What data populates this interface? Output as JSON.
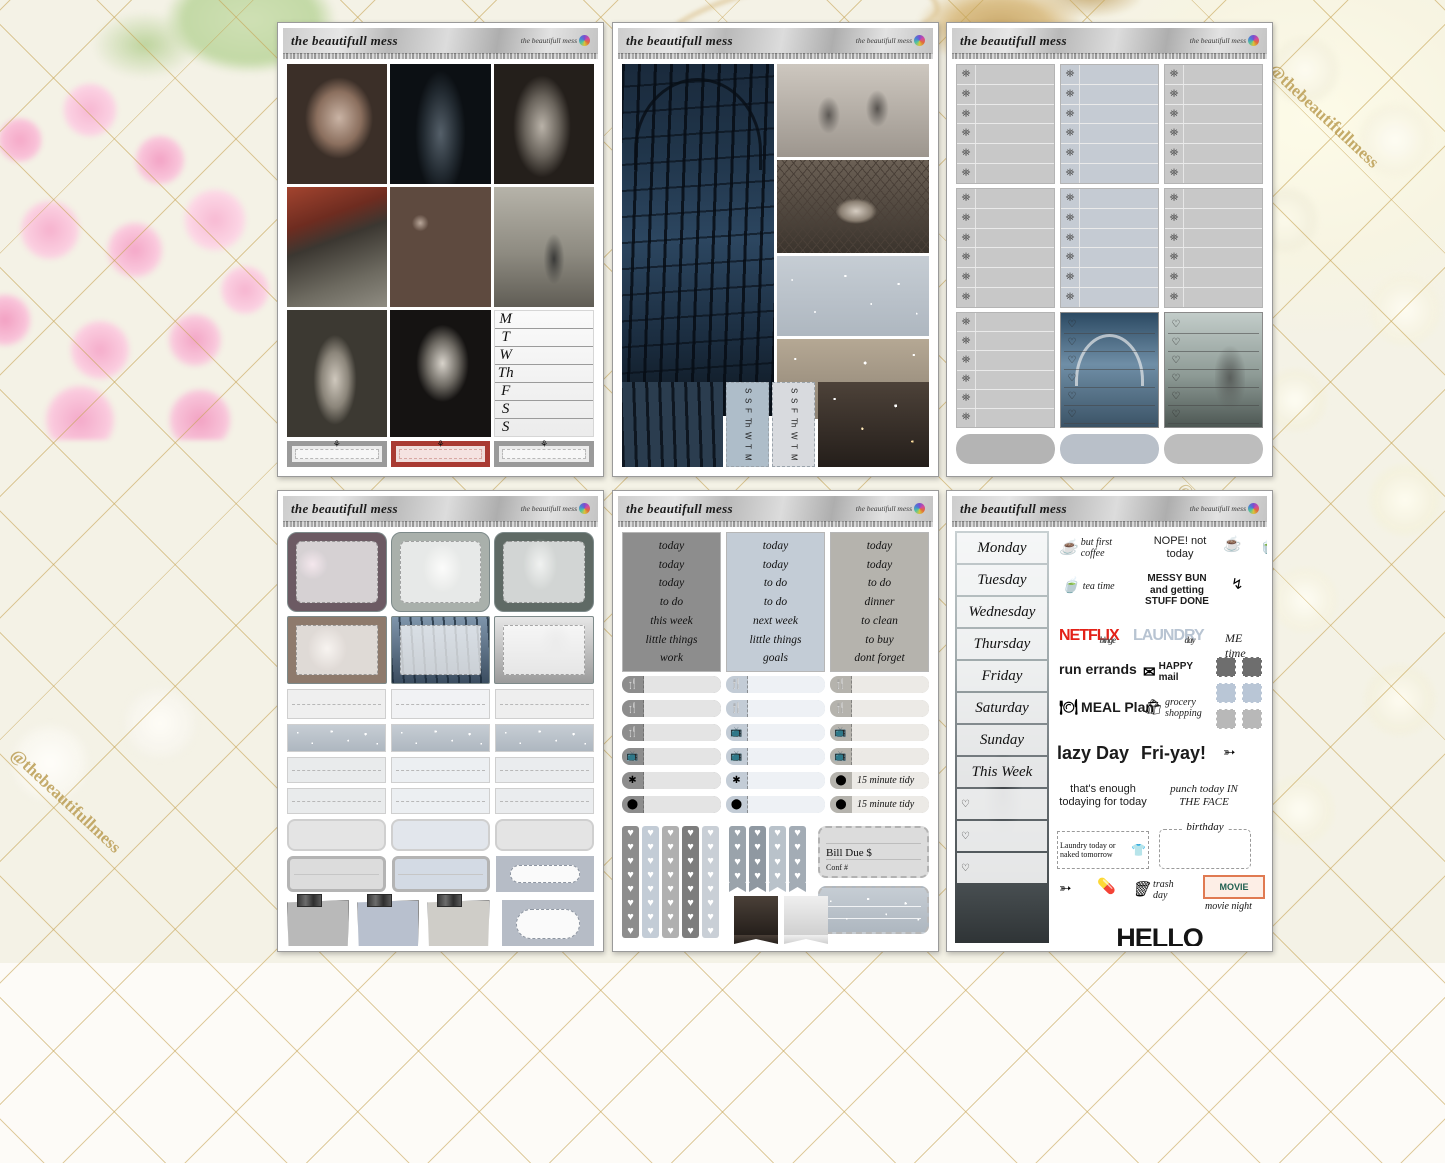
{
  "watermark": {
    "text": "@thebeautifullmess"
  },
  "brand": {
    "title": "the beautifull mess",
    "small": "the beautifull mess",
    "logo_icon": "rainbow-circle-logo"
  },
  "sheets": [
    {
      "id": "sheet-1",
      "name": "horror-photo-weekly-kit",
      "photos": [
        "zombie-woman-portrait",
        "dark-corridor-figure",
        "girl-with-camera",
        "crawling-figure-field",
        "bloody-hands-zombie",
        "lone-figure-fog",
        "bare-feet-walking",
        "long-hair-ghost-girl"
      ],
      "weekly_days": [
        "M",
        "T",
        "W",
        "Th",
        "F",
        "S",
        "S"
      ],
      "bow_boxes": [
        {
          "icon": "bow-icon",
          "accent": "#9a9a9a"
        },
        {
          "icon": "bow-icon",
          "accent": "#a93a32"
        },
        {
          "icon": "bow-icon",
          "accent": "#b5b5b5"
        }
      ]
    },
    {
      "id": "sheet-2",
      "name": "gothic-gate-photo-kit",
      "photos": [
        "gothic-iron-gate-tall",
        "iron-fence-gate",
        "shadow-hands-frosted-glass",
        "hand-reaching-net",
        "silver-glitter-texture",
        "gold-glitter-texture",
        "cemetery-gate-detail"
      ],
      "vertical_days": [
        "M",
        "T",
        "W",
        "Th",
        "F",
        "S",
        "S"
      ]
    },
    {
      "id": "sheet-3",
      "name": "tombstone-checklist-kit",
      "icon": "tombstone-icon",
      "columns": [
        {
          "rows": 12,
          "shade": "#c8c8c8"
        },
        {
          "rows": 12,
          "shade": "#c5cbd3"
        },
        {
          "rows": 12,
          "shade": "#c8c8c8"
        }
      ],
      "heart_lists": [
        {
          "icon": "heart-icon",
          "bg": "cemetery-arch-photo",
          "rows": 6
        },
        {
          "icon": "heart-icon",
          "bg": "figure-in-mist-photo",
          "rows": 6
        }
      ],
      "cloud_bars": [
        "#b4b4b4",
        "#b9c0c9",
        "#bdbdbd"
      ]
    },
    {
      "id": "sheet-4",
      "name": "photo-note-boxes-kit",
      "photo_notes": [
        "flower-blur-photo",
        "ghost-white-figure-photo",
        "long-hair-ghost-photo",
        "girl-in-grass-photo",
        "iron-bridge-photo",
        "hands-on-glass-photo"
      ],
      "taped_notes": [
        "#b9b9b9",
        "#b8c0ce",
        "#cfcdc8"
      ],
      "cloud_boxes": 2
    },
    {
      "id": "sheet-5",
      "name": "to-do-word-kit",
      "word_columns": [
        {
          "bg": "#8d8d8d",
          "words": [
            "today",
            "today",
            "today",
            "to do",
            "this week",
            "little things",
            "work"
          ]
        },
        {
          "bg": "#c3ccd6",
          "words": [
            "today",
            "today",
            "to do",
            "to do",
            "next week",
            "little things",
            "goals"
          ]
        },
        {
          "bg": "#b5b3ad",
          "words": [
            "today",
            "today",
            "to do",
            "dinner",
            "to clean",
            "to buy",
            "dont forget"
          ]
        }
      ],
      "icon_bars": [
        {
          "icon": "fork-knife-icon",
          "shade": "#9a9a9a"
        },
        {
          "icon": "fork-knife-icon",
          "shade": "#9a9a9a"
        },
        {
          "icon": "fork-knife-icon",
          "shade": "#9a9a9a"
        },
        {
          "icon": "tv-icon",
          "shade": "#9a9a9a"
        },
        {
          "icon": "asterisk-icon",
          "shade": "#9a9a9a"
        },
        {
          "icon": "circle-icon",
          "shade": "#9a9a9a"
        }
      ],
      "tidy_labels": [
        "15 minute tidy",
        "15 minute tidy"
      ],
      "heart_strips": 5,
      "flags": 4,
      "bill_box": {
        "line1": "Bill Due $",
        "line2": "Conf #"
      }
    },
    {
      "id": "sheet-6",
      "name": "days-and-phrases-kit",
      "days": [
        "Monday",
        "Tuesday",
        "Wednesday",
        "Thursday",
        "Friday",
        "Saturday",
        "Sunday",
        "This Week"
      ],
      "phrases": [
        {
          "text": "but first coffee",
          "icon": "coffee-cup-icon",
          "color": "#1b1b1b"
        },
        {
          "text": "NOPE! not today",
          "icon": "none",
          "color": "#1b1b1b"
        },
        {
          "text": "",
          "icon": "coffee-cup-icon",
          "color": "#1b1b1b"
        },
        {
          "text": "",
          "icon": "teacup-icon",
          "color": "#1b1b1b"
        },
        {
          "text": "tea time",
          "icon": "teacup-icon",
          "color": "#1b1b1b"
        },
        {
          "text": "MESSY BUN and getting STUFF DONE",
          "icon": "none",
          "color": "#1b1b1b"
        },
        {
          "text": "",
          "icon": "swirl-arrow-icon",
          "color": "#1b1b1b"
        },
        {
          "text": "NETFLIX",
          "sub": "binge",
          "icon": "none",
          "color": "#e32118"
        },
        {
          "text": "LAUNDRY",
          "sub": "day",
          "icon": "none",
          "color": "#b8c4d2"
        },
        {
          "text": "ME time",
          "icon": "none",
          "color": "#1b1b1b"
        },
        {
          "text": "run errands",
          "icon": "none",
          "color": "#1b1b1b"
        },
        {
          "text": "HAPPY mail",
          "icon": "envelope-icon",
          "color": "#1b1b1b"
        },
        {
          "text": "MEAL Plan",
          "icon": "plate-fork-knife-icon",
          "color": "#1b1b1b"
        },
        {
          "text": "grocery shopping",
          "icon": "grocery-bag-icon",
          "color": "#1b1b1b"
        },
        {
          "text": "lazy Day",
          "icon": "none",
          "color": "#1b1b1b"
        },
        {
          "text": "Fri-yay!",
          "icon": "none",
          "color": "#1b1b1b"
        },
        {
          "text": "",
          "icon": "curved-arrow-icon",
          "color": "#1b1b1b"
        },
        {
          "text": "that's enough todaying for today",
          "icon": "none",
          "color": "#1b1b1b"
        },
        {
          "text": "punch today IN THE FACE",
          "icon": "none",
          "color": "#1b1b1b"
        },
        {
          "text": "Laundry today or naked tomorrow",
          "icon": "clothesline-icon",
          "color": "#1b1b1b"
        },
        {
          "text": "birthday",
          "icon": "none",
          "color": "#1b1b1b"
        },
        {
          "text": "",
          "icon": "curved-arrow-icon",
          "color": "#1b1b1b"
        },
        {
          "text": "",
          "icon": "pill-bottle-icon",
          "color": "#1b1b1b"
        },
        {
          "text": "trash day",
          "icon": "trash-can-icon",
          "color": "#1b1b1b"
        },
        {
          "text": "movie night",
          "icon": "movie-ticket-icon",
          "color": "#1b1b1b"
        }
      ],
      "movie_ticket_label": "MOVIE",
      "hello_weekend": "HELLO WEEKEND",
      "square_swatches": [
        "#6e6e6e",
        "#6e6e6e",
        "#b9c6d6",
        "#b9c6d6",
        "#b8b8b8",
        "#b8b8b8"
      ]
    }
  ]
}
